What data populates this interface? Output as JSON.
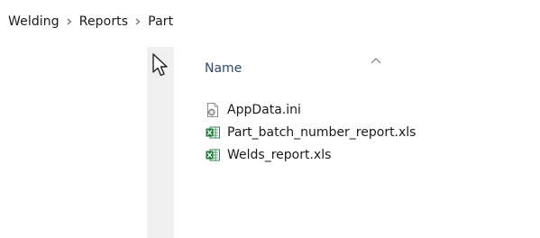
{
  "breadcrumb": {
    "items": [
      {
        "label": "Welding"
      },
      {
        "label": "Reports"
      },
      {
        "label": "Part"
      }
    ]
  },
  "column_header": {
    "label": "Name",
    "sort_icon": "sort-ascending-caret-icon"
  },
  "files": [
    {
      "name": "AppData.ini",
      "icon": "ini-settings-file-icon"
    },
    {
      "name": "Part_batch_number_report.xls",
      "icon": "excel-file-icon"
    },
    {
      "name": "Welds_report.xls",
      "icon": "excel-file-icon"
    }
  ],
  "colors": {
    "header_text": "#2d4a6d",
    "nav_strip": "#f0f0f0",
    "excel_green": "#1f7a3c"
  }
}
